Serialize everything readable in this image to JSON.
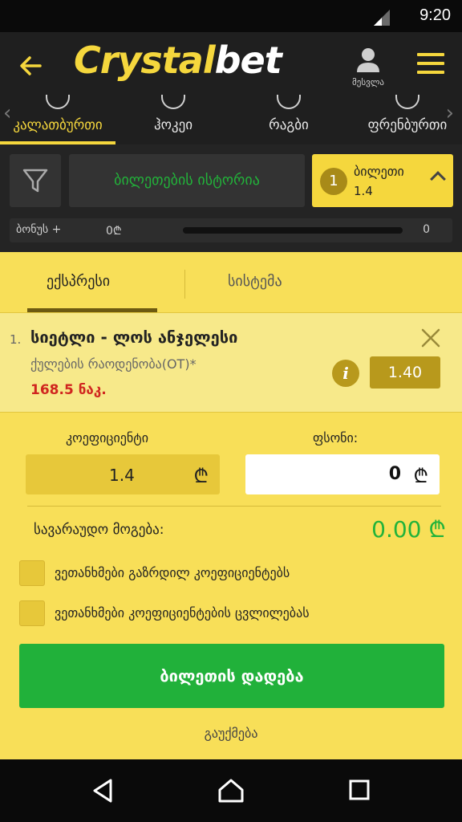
{
  "status_bar": {
    "time": "9:20"
  },
  "header": {
    "logo_main": "Crystal",
    "logo_suffix": "bet",
    "profile_label": "მესვლა"
  },
  "sport_tabs": [
    {
      "label": "კალათბურთი",
      "active": true
    },
    {
      "label": "ჰოკეი",
      "active": false
    },
    {
      "label": "რაგბი",
      "active": false
    },
    {
      "label": "ფრენბურთი",
      "active": false
    }
  ],
  "filters": {
    "history_label": "ბილეთების ისტორია",
    "tickets_count": "1",
    "tickets_label": "ბილეთი",
    "tickets_value": "1.4"
  },
  "bonus": {
    "label": "ბონუს +",
    "value": "0₾",
    "end_value": "0",
    "progress": 0
  },
  "bet_type_tabs": {
    "express": "ექსპრესი",
    "system": "სისტემა"
  },
  "bet_item": {
    "number": "1.",
    "match": "სიეტლი - ლოს ანჯელესი",
    "market": "ქულების რაოდენობა(OT)*",
    "line": "168.5 ნაკ.",
    "odd": "1.40"
  },
  "fields": {
    "coef_label": "კოეფიციენტი",
    "coef_value": "1.4",
    "stake_label": "ფსონი:",
    "stake_value": "0",
    "currency": "₾",
    "win_label": "სავარაუდო მოგება:",
    "win_value": "0.00 ₾"
  },
  "checkboxes": {
    "increased_odds": "ვეთანხმები გაზრდილ კოეფიციენტებს",
    "odds_change": "ვეთანხმები კოეფიციენტების ცვლილებას"
  },
  "actions": {
    "place_bet": "ბილეთის დადება",
    "cancel": "გაუქმება"
  },
  "colors": {
    "brand_yellow": "#f5d73d",
    "accent_green": "#21b13a",
    "error_red": "#d0261f"
  }
}
